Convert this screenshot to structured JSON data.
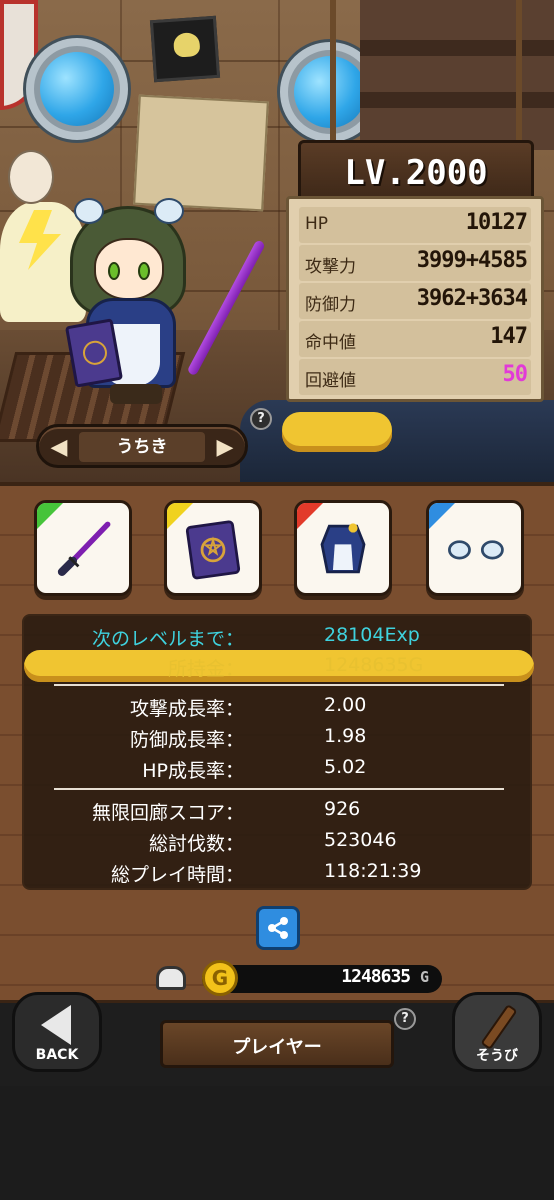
{
  "character": {
    "name": "うちき",
    "level_label": "LV.2000"
  },
  "stats_panel": [
    {
      "label": "HP",
      "value": "10127",
      "color": "#231508"
    },
    {
      "label": "攻撃力",
      "value": "3999+4585",
      "color": "#231508"
    },
    {
      "label": "防御力",
      "value": "3962+3634",
      "color": "#231508"
    },
    {
      "label": "命中値",
      "value": "147",
      "color": "#231508"
    },
    {
      "label": "回避値",
      "value": "50",
      "color": "#e23ad8"
    }
  ],
  "equipment": [
    {
      "slot": "weapon",
      "icon": "katana-icon",
      "corner_color": "#46c43a"
    },
    {
      "slot": "book",
      "icon": "spellbook-icon",
      "corner_color": "#f0d21e"
    },
    {
      "slot": "armor",
      "icon": "armor-icon",
      "corner_color": "#e23a2a"
    },
    {
      "slot": "accessory",
      "icon": "hair-ornament-icon",
      "corner_color": "#2f8de0"
    }
  ],
  "info": {
    "next_level_label": "次のレベルまで：",
    "next_level_value": "28104Exp",
    "money_label": "所持金：",
    "money_value": "1248635G",
    "atk_growth_label": "攻撃成長率：",
    "atk_growth_value": "2.00",
    "def_growth_label": "防御成長率：",
    "def_growth_value": "1.98",
    "hp_growth_label": "HP成長率：",
    "hp_growth_value": "5.02",
    "corridor_label": "無限回廊スコア：",
    "corridor_value": "926",
    "kills_label": "総討伐数：",
    "kills_value": "523046",
    "playtime_label": "総プレイ時間：",
    "playtime_value": "118:21:39"
  },
  "currency": {
    "coin_symbol": "G",
    "amount": "1248635",
    "unit": "G"
  },
  "nav": {
    "back_label": "BACK",
    "title": "プレイヤー",
    "equip_label": "そうび",
    "help_mark": "?"
  },
  "colors": {
    "cyan": "#3fd2de",
    "gold": "#e8c130",
    "wood": "#744a2c"
  }
}
